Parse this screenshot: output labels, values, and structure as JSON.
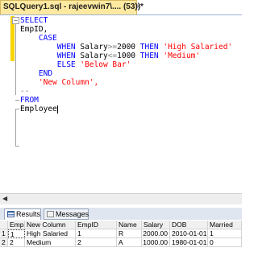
{
  "tab": {
    "title": "SQLQuery1.sql - rajeevwin7\\.... (53))*",
    "close": "×"
  },
  "code_lines": [
    [
      {
        "t": "SELECT",
        "c": "kw"
      }
    ],
    [
      {
        "t": "EmpID,",
        "c": "plain"
      }
    ],
    [
      {
        "t": "    CASE",
        "c": "kw"
      }
    ],
    [
      {
        "t": "        WHEN ",
        "c": "kw"
      },
      {
        "t": "Salary",
        "c": "plain"
      },
      {
        "t": ">=",
        "c": "op"
      },
      {
        "t": "2000 ",
        "c": "plain"
      },
      {
        "t": "THEN ",
        "c": "kw"
      },
      {
        "t": "'High Salaried'",
        "c": "str"
      }
    ],
    [
      {
        "t": "        WHEN ",
        "c": "kw"
      },
      {
        "t": "Salary",
        "c": "plain"
      },
      {
        "t": "<=",
        "c": "op"
      },
      {
        "t": "1000 ",
        "c": "plain"
      },
      {
        "t": "THEN ",
        "c": "kw"
      },
      {
        "t": "'Medium'",
        "c": "str"
      }
    ],
    [
      {
        "t": "        ELSE ",
        "c": "kw"
      },
      {
        "t": "'Below Bar'",
        "c": "str"
      }
    ],
    [
      {
        "t": "    END",
        "c": "kw"
      }
    ],
    [
      {
        "t": "    'New Column',",
        "c": "str"
      }
    ],
    [
      {
        "t": "--",
        "c": "op"
      }
    ],
    [
      {
        "t": "FROM",
        "c": "kw"
      }
    ],
    [
      {
        "t": "Employee",
        "c": "plain"
      }
    ]
  ],
  "results_tabs": {
    "results": "Results",
    "messages": "Messages"
  },
  "grid": {
    "columns": [
      "EmpID",
      "New Column",
      "EmpID",
      "Name",
      "Salary",
      "DOB",
      "Married"
    ],
    "rows": [
      {
        "num": "1",
        "cells": [
          "1",
          "High Salaried",
          "1",
          "R",
          "2000.00",
          "2010-01-01",
          "1"
        ]
      },
      {
        "num": "2",
        "cells": [
          "2",
          "Medium",
          "2",
          "A",
          "1000.00",
          "1980-01-01",
          "0"
        ]
      }
    ]
  }
}
